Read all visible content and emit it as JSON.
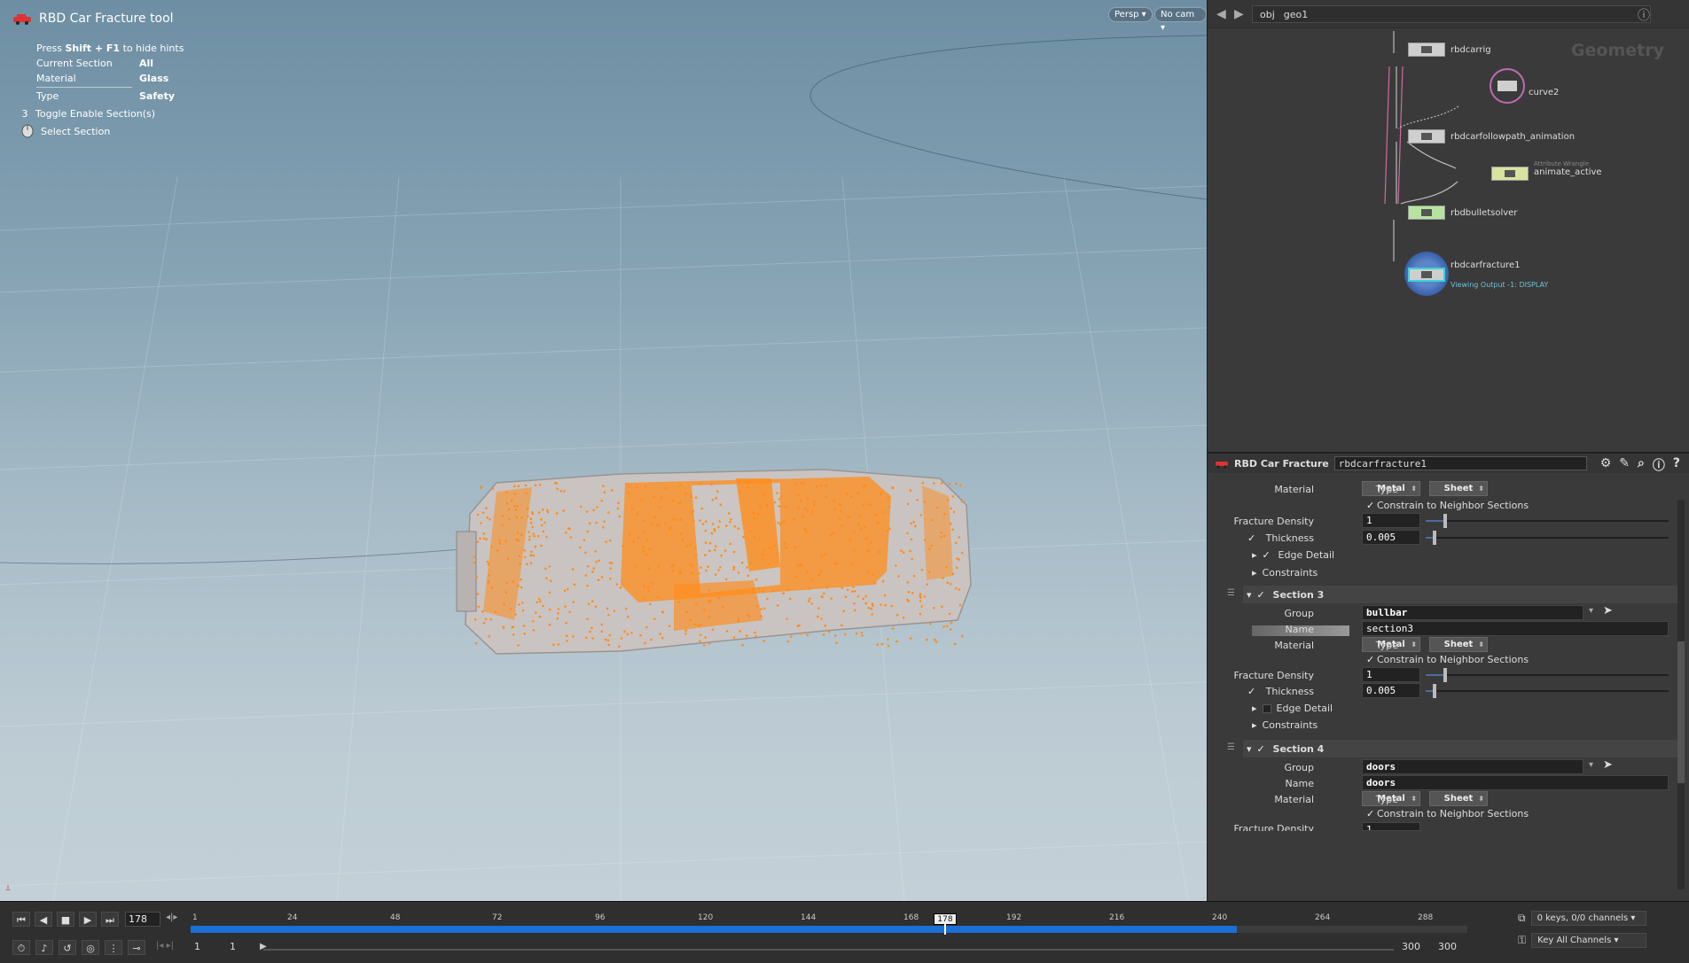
{
  "viewport": {
    "tool_title": "RBD Car Fracture tool",
    "press_prefix": "Press",
    "press_keys": "Shift + F1",
    "press_suffix": "to hide hints",
    "info": [
      {
        "label": "Current Section",
        "value": "All"
      },
      {
        "label": "Material",
        "value": "Glass"
      },
      {
        "label": "Type",
        "value": "Safety"
      }
    ],
    "actions": [
      {
        "key": "3",
        "label": "Toggle Enable Section(s)"
      },
      {
        "key": "",
        "label": "Select Section"
      }
    ],
    "persp_label": "Persp",
    "cam_label": "No cam"
  },
  "network": {
    "path": [
      "obj",
      "geo1"
    ],
    "context_label": "Geometry",
    "nodes": [
      {
        "name": "rbdcarrig"
      },
      {
        "name": "curve2"
      },
      {
        "name": "rbdcarfollowpath_animation"
      },
      {
        "name": "animate_active",
        "subtitle": "Attribute Wrangle"
      },
      {
        "name": "rbdbulletsolver"
      },
      {
        "name": "rbdcarfracture1",
        "status": "Viewing Output -1: DISPLAY"
      }
    ]
  },
  "parms": {
    "op_label": "RBD Car Fracture",
    "node_name": "rbdcarfracture1",
    "labels": {
      "material": "Material",
      "type": "Type",
      "constrain": "Constrain to Neighbor Sections",
      "fracture_density": "Fracture Density",
      "thickness": "Thickness",
      "edge_detail": "Edge Detail",
      "constraints": "Constraints",
      "group": "Group",
      "name": "Name"
    },
    "section_top": {
      "material": "Metal",
      "type": "Sheet",
      "fracture_density": "1",
      "thickness": "0.005"
    },
    "section3": {
      "title": "Section 3",
      "group": "bullbar",
      "name": "section3",
      "material": "Metal",
      "type": "Sheet",
      "fracture_density": "1",
      "thickness": "0.005"
    },
    "section4": {
      "title": "Section 4",
      "group": "doors",
      "name": "doors",
      "material": "Metal",
      "type": "Sheet",
      "fracture_density": "1"
    }
  },
  "timeline": {
    "current_frame": "178",
    "start": "1",
    "start2": "1",
    "end": "300",
    "end2": "300",
    "ticks": [
      "1",
      "24",
      "48",
      "72",
      "96",
      "120",
      "144",
      "168",
      "192",
      "216",
      "240",
      "264",
      "288"
    ],
    "keys_label": "0 keys, 0/0 channels",
    "key_all_label": "Key All Channels"
  },
  "colors": {
    "accent": "#1c6fd6",
    "point_orange": "#ff8c1a",
    "node_green": "#b6e4a0"
  }
}
